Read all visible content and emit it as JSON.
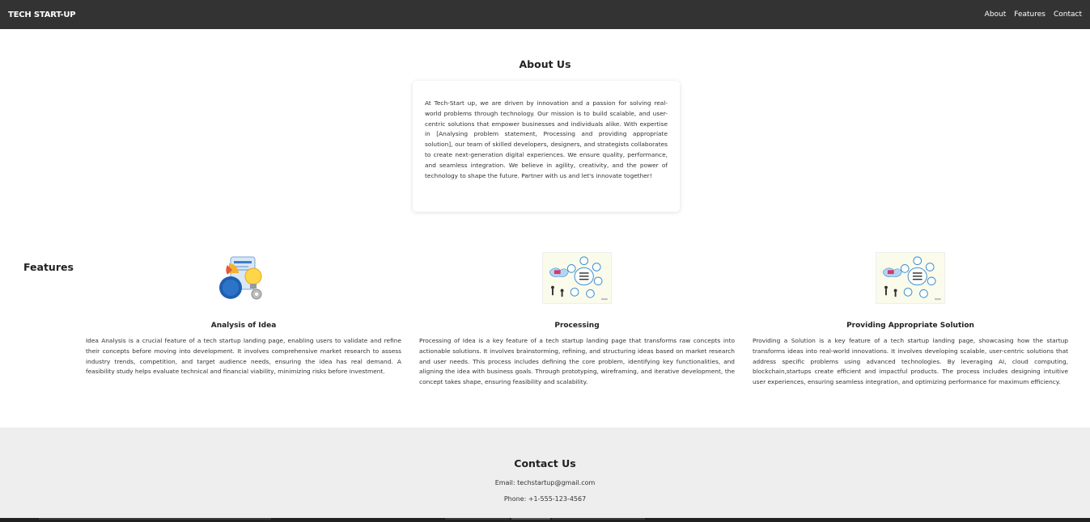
{
  "navbar": {
    "brand": "TECH START-UP",
    "links": [
      "About",
      "Features",
      "Contact"
    ]
  },
  "about": {
    "title": "About Us",
    "text": "At Tech-Start up, we are driven by innovation and a passion for solving real-world problems through technology. Our mission is to build scalable, and user-centric solutions that empower businesses and individuals alike. With expertise in [Analysing problem statement, Processing and providing appropriate solution], our team of skilled developers, designers, and strategists collaborates to create next-generation digital experiences. We ensure quality, performance, and seamless integration. We believe in agility, creativity, and the power of technology to shape the future. Partner with us and let's innovate together!"
  },
  "features": {
    "title": "Features",
    "items": [
      {
        "title": "Analysis of Idea",
        "image": "idea-analysis-illustration",
        "text": "Idea Analysis is a crucial feature of a tech startup landing page, enabling users to validate and refine their concepts before moving into development. It involves comprehensive market research to assess industry trends, competition, and target audience needs, ensuring the idea has real demand. A feasibility study helps evaluate technical and financial viability, minimizing risks before investment."
      },
      {
        "title": "Processing",
        "image": "business-process-diagram",
        "text": "Processing of Idea is a key feature of a tech startup landing page that transforms raw concepts into actionable solutions. It involves brainstorming, refining, and structuring ideas based on market research and user needs. This process includes defining the core problem, identifying key functionalities, and aligning the idea with business goals. Through prototyping, wireframing, and iterative development, the concept takes shape, ensuring feasibility and scalability."
      },
      {
        "title": "Providing Appropriate Solution",
        "image": "business-process-diagram",
        "text": "Providing a Solution is a key feature of a tech startup landing page, showcasing how the startup transforms ideas into real-world innovations. It involves developing scalable, user-centric solutions that address specific problems using advanced technologies. By leveraging AI, cloud computing, blockchain,startups create efficient and impactful products. The process includes designing intuitive user experiences, ensuring seamless integration, and optimizing performance for maximum efficiency."
      }
    ]
  },
  "contact": {
    "title": "Contact Us",
    "email": "Email: techstartup@gmail.com",
    "phone": "Phone: +1-555-123-4567"
  },
  "colors": {
    "navbar_bg": "#333333",
    "contact_bg": "#eeeeee",
    "text": "#222222"
  }
}
